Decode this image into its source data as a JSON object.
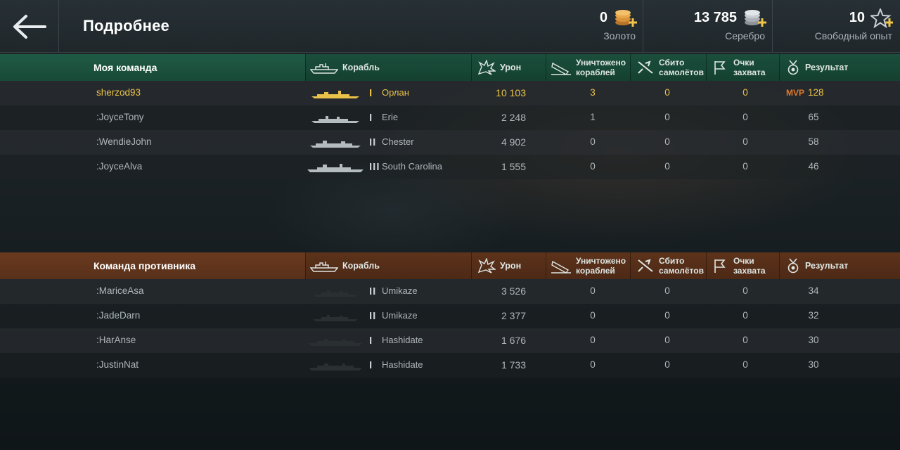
{
  "header": {
    "title": "Подробнее",
    "gold": {
      "amount": "0",
      "label": "Золото"
    },
    "silver": {
      "amount": "13 785",
      "label": "Серебро"
    },
    "free_xp": {
      "amount": "10",
      "label": "Свободный опыт"
    }
  },
  "columns": {
    "ship": "Корабль",
    "damage": "Урон",
    "destroyed_1": "Уничтожено",
    "destroyed_2": "кораблей",
    "planes_1": "Сбито",
    "planes_2": "самолётов",
    "capture_1": "Очки",
    "capture_2": "захвата",
    "result": "Результат"
  },
  "my_team": {
    "title": "Моя команда",
    "rows": [
      {
        "player": "sherzod93",
        "tier": "I",
        "ship": "Орлан",
        "damage": "10 103",
        "destroyed": "3",
        "planes": "0",
        "capture": "0",
        "mvp": "MVP",
        "result": "128"
      },
      {
        "player": ":JoyceTony",
        "tier": "I",
        "ship": "Erie",
        "damage": "2 248",
        "destroyed": "1",
        "planes": "0",
        "capture": "0",
        "result": "65"
      },
      {
        "player": ":WendieJohn",
        "tier": "II",
        "ship": "Chester",
        "damage": "4 902",
        "destroyed": "0",
        "planes": "0",
        "capture": "0",
        "result": "58"
      },
      {
        "player": ":JoyceAlva",
        "tier": "III",
        "ship": "South Carolina",
        "damage": "1 555",
        "destroyed": "0",
        "planes": "0",
        "capture": "0",
        "result": "46"
      }
    ]
  },
  "enemy_team": {
    "title": "Команда противника",
    "rows": [
      {
        "player": ":MariceAsa",
        "tier": "II",
        "ship": "Umikaze",
        "damage": "3 526",
        "destroyed": "0",
        "planes": "0",
        "capture": "0",
        "result": "34"
      },
      {
        "player": ":JadeDarn",
        "tier": "II",
        "ship": "Umikaze",
        "damage": "2 377",
        "destroyed": "0",
        "planes": "0",
        "capture": "0",
        "result": "32"
      },
      {
        "player": ":HarAnse",
        "tier": "I",
        "ship": "Hashidate",
        "damage": "1 676",
        "destroyed": "0",
        "planes": "0",
        "capture": "0",
        "result": "30"
      },
      {
        "player": ":JustinNat",
        "tier": "I",
        "ship": "Hashidate",
        "damage": "1 733",
        "destroyed": "0",
        "planes": "0",
        "capture": "0",
        "result": "30"
      }
    ]
  },
  "icons": {
    "back": "back-arrow-icon",
    "gold": "gold-coins-icon",
    "silver": "silver-coins-icon",
    "free_xp": "star-icon",
    "ship": "ship-icon",
    "damage": "explosion-icon",
    "destroyed": "sinking-ship-icon",
    "planes": "plane-shot-icon",
    "capture": "flag-icon",
    "result": "medal-icon"
  },
  "colors": {
    "my_team_header": "#1f5a45",
    "enemy_team_header": "#6a3a1f",
    "highlight_player": "#e9c24a",
    "mvp": "#e07a2a"
  }
}
